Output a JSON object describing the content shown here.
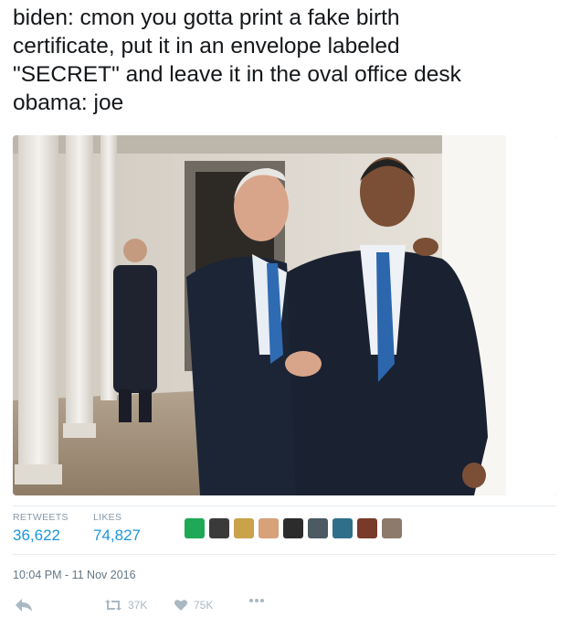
{
  "tweet": {
    "text": "biden: cmon you gotta print a fake birth\ncertificate, put it in an envelope labeled\n\"SECRET\" and leave it in the oval office desk\nobama: joe"
  },
  "media": {
    "description_icon": "photo-of-two-men-walking-colonnade"
  },
  "stats": {
    "retweets_label": "RETWEETS",
    "retweets_value": "36,622",
    "likes_label": "LIKES",
    "likes_value": "74,827"
  },
  "likers": {
    "avatars": [
      {
        "name": "liker-avatar-1",
        "color": "#1fa855"
      },
      {
        "name": "liker-avatar-2",
        "color": "#3a3a3a"
      },
      {
        "name": "liker-avatar-3",
        "color": "#c9a24a"
      },
      {
        "name": "liker-avatar-4",
        "color": "#d7a17a"
      },
      {
        "name": "liker-avatar-5",
        "color": "#2c2c2c"
      },
      {
        "name": "liker-avatar-6",
        "color": "#4b5a63"
      },
      {
        "name": "liker-avatar-7",
        "color": "#2f6f8a"
      },
      {
        "name": "liker-avatar-8",
        "color": "#7a3a2a"
      },
      {
        "name": "liker-avatar-9",
        "color": "#8d7a6a"
      }
    ]
  },
  "meta": {
    "timestamp": "10:04 PM - 11 Nov 2016"
  },
  "actions": {
    "reply_icon": "reply-icon",
    "retweet_count": "37K",
    "like_count": "75K",
    "more_icon": "more-icon"
  },
  "colors": {
    "accent": "#1b95e0",
    "muted": "#aab8c2",
    "label": "#8899a6"
  }
}
